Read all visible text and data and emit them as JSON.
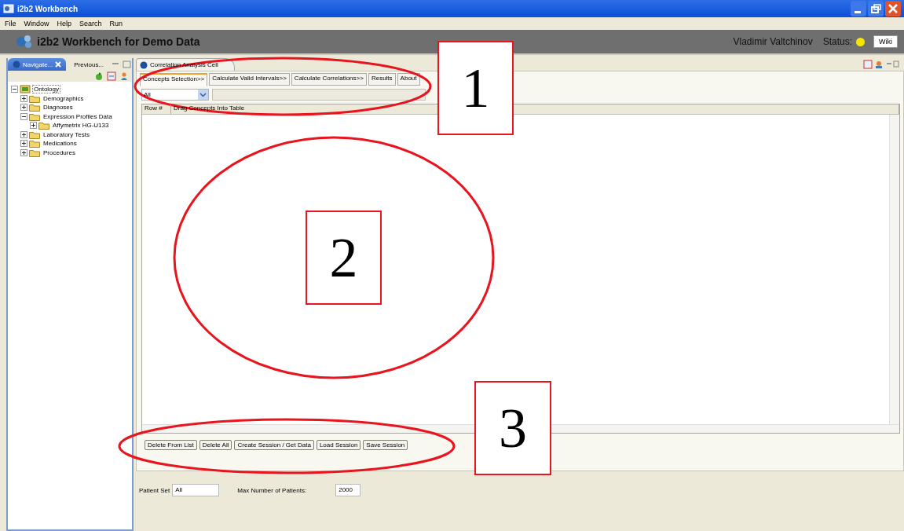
{
  "window": {
    "title": "i2b2 Workbench"
  },
  "menu": [
    "File",
    "Window",
    "Help",
    "Search",
    "Run"
  ],
  "header": {
    "title": "i2b2 Workbench for Demo Data",
    "user": "Vladimir Valtchinov",
    "status_label": "Status:",
    "status_dot": {
      "color": "#f5e600"
    },
    "wiki_button": "Wiki"
  },
  "left_panel": {
    "tabs": [
      {
        "label": "Navigate...",
        "selected": true
      },
      {
        "label": "Previous...",
        "selected": false
      }
    ],
    "tree": [
      {
        "label": "Ontology",
        "expanded": true,
        "selected": true,
        "children": [
          {
            "label": "Demographics",
            "expanded": false,
            "selected": false
          },
          {
            "label": "Diagnoses",
            "expanded": false,
            "selected": false
          },
          {
            "label": "Expression Profiles Data",
            "expanded": true,
            "selected": false,
            "children": [
              {
                "label": "Affymetrix HG-U133",
                "expanded": false,
                "selected": false
              }
            ]
          },
          {
            "label": "Laboratory Tests",
            "expanded": false,
            "selected": false
          },
          {
            "label": "Medications",
            "expanded": false,
            "selected": false
          },
          {
            "label": "Procedures",
            "expanded": false,
            "selected": false
          }
        ]
      }
    ]
  },
  "main": {
    "view_title": "Correlation Analysis Cell",
    "tabs": [
      {
        "label": "Concepts Selection>>",
        "selected": true
      },
      {
        "label": "Calculate Valid Intervals>>",
        "selected": false
      },
      {
        "label": "Calculate Correlations>>",
        "selected": false
      },
      {
        "label": "Results",
        "selected": false
      },
      {
        "label": "About",
        "selected": false
      }
    ],
    "filter": {
      "value": "All"
    },
    "table": {
      "columns": [
        "Row #",
        "Drag Concepts Into Table"
      ]
    },
    "buttons": [
      "Delete From List",
      "Delete All",
      "Create Session / Get Data",
      "Load Session",
      "Save Session"
    ],
    "patient_set": {
      "label": "Patient Set",
      "value": "All"
    },
    "max_patients": {
      "label": "Max Number of Patients:",
      "value": "2000"
    }
  },
  "annotations": [
    {
      "label": "1"
    },
    {
      "label": "2"
    },
    {
      "label": "3"
    }
  ]
}
